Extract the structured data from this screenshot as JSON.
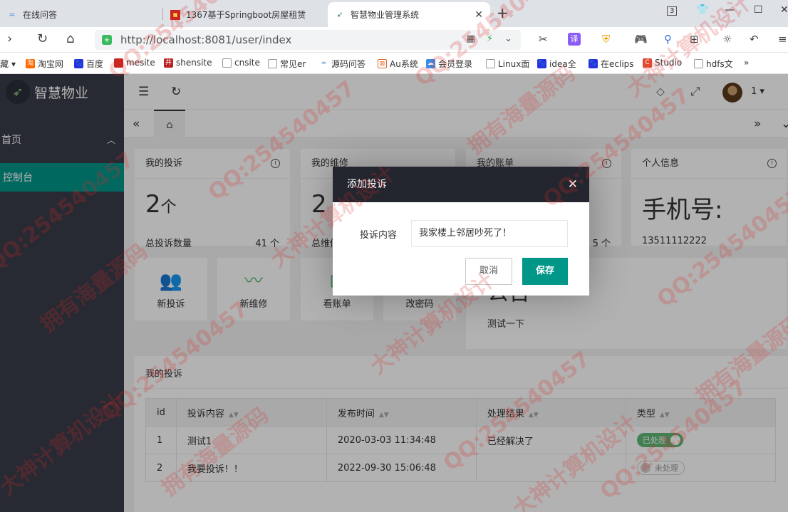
{
  "browser": {
    "tabs": [
      {
        "label": "在线问答",
        "icon": "wave-icon"
      },
      {
        "label": "1367基于Springboot房屋租赁",
        "icon": "red-square-icon"
      },
      {
        "label": "智慧物业管理系统",
        "icon": "rocket-icon"
      }
    ],
    "tab_count": "3",
    "url": "http://localhost:8081/user/index",
    "bookmarks": [
      "藏",
      "淘宝网",
      "百度",
      "mesite",
      "shensite",
      "cnsite",
      "常见er",
      "源码问答",
      "Au系统",
      "会员登录",
      "Linux面",
      "idea全",
      "在eclips",
      "Studio",
      "hdfs文"
    ],
    "bookmark_more": "»"
  },
  "sidebar": {
    "logo_text": "智慧物业",
    "home_label": "首页",
    "console_label": "控制台"
  },
  "header": {
    "username": "1"
  },
  "cards": {
    "complaint": {
      "title": "我的投诉",
      "value": "2",
      "unit": "个",
      "sub_label": "总投诉数量",
      "sub_value": "41 个"
    },
    "repair": {
      "title": "我的维修",
      "value": "2",
      "sub_label": "总维修"
    },
    "bill": {
      "title": "我的账单",
      "sub_value": "5 个"
    },
    "profile": {
      "title": "个人信息",
      "value": "手机号:",
      "sub_label": "13511112222"
    }
  },
  "quick": [
    {
      "label": "新投诉",
      "icon": "users-icon"
    },
    {
      "label": "新维修",
      "icon": "pulse-icon"
    },
    {
      "label": "看账单",
      "icon": "bill-icon"
    },
    {
      "label": "改密码",
      "icon": "key-icon"
    }
  ],
  "notice": {
    "title": "公告",
    "content": "测试一下"
  },
  "table": {
    "title": "我的投诉",
    "columns": [
      "id",
      "投诉内容",
      "发布时间",
      "处理结果",
      "类型"
    ],
    "rows": [
      {
        "id": "1",
        "content": "测试1",
        "time": "2020-03-03 11:34:48",
        "result": "已经解决了",
        "status": "已处理"
      },
      {
        "id": "2",
        "content": "我要投诉！！",
        "time": "2022-09-30 15:06:48",
        "result": "",
        "status": "未处理"
      }
    ]
  },
  "modal": {
    "title": "添加投诉",
    "field_label": "投诉内容",
    "field_value": "我家楼上邻居吵死了！",
    "cancel": "取消",
    "save": "保存"
  },
  "watermarks": [
    "QQ:254540457",
    "拥有海量源码",
    "大神计算机设计"
  ],
  "colors": {
    "sidebar": "#393d49",
    "accent": "#009688",
    "modal_header": "#23262e",
    "switch_on": "#5fb878"
  }
}
